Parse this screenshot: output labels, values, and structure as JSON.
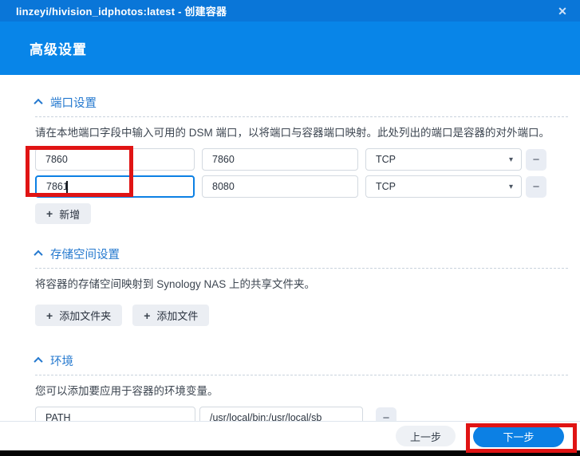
{
  "window": {
    "title": "linzeyi/hivision_idphotos:latest - 创建容器",
    "dialog_title": "高级设置"
  },
  "icons": {
    "close": "✕",
    "plus": "+",
    "minus": "−",
    "caret_down": "▾"
  },
  "sections": {
    "ports": {
      "title": "端口设置",
      "description": "请在本地端口字段中输入可用的 DSM 端口，以将端口与容器端口映射。此处列出的端口是容器的对外端口。",
      "rows": [
        {
          "local_port": "7860",
          "container_port": "7860",
          "protocol": "TCP"
        },
        {
          "local_port": "7861",
          "container_port": "8080",
          "protocol": "TCP"
        }
      ],
      "add_button": "新增"
    },
    "storage": {
      "title": "存储空间设置",
      "description": "将容器的存储空间映射到 Synology NAS 上的共享文件夹。",
      "add_folder_button": "添加文件夹",
      "add_file_button": "添加文件"
    },
    "env": {
      "title": "环境",
      "description": "您可以添加要应用于容器的环境变量。",
      "rows": [
        {
          "name": "PATH",
          "value": "/usr/local/bin:/usr/local/sb"
        }
      ]
    }
  },
  "footer": {
    "back_button": "上一步",
    "next_button": "下一步"
  },
  "colors": {
    "titlebar_bg": "#0a76d8",
    "header_bg": "#0885e8",
    "section_title_blue": "#2579cf",
    "accent_blue": "#0c80e4",
    "annotation_red": "#e01414",
    "input_border": "#d3d9e0",
    "button_gray_bg": "#ebeef3",
    "bottom_strip": "#050505"
  }
}
